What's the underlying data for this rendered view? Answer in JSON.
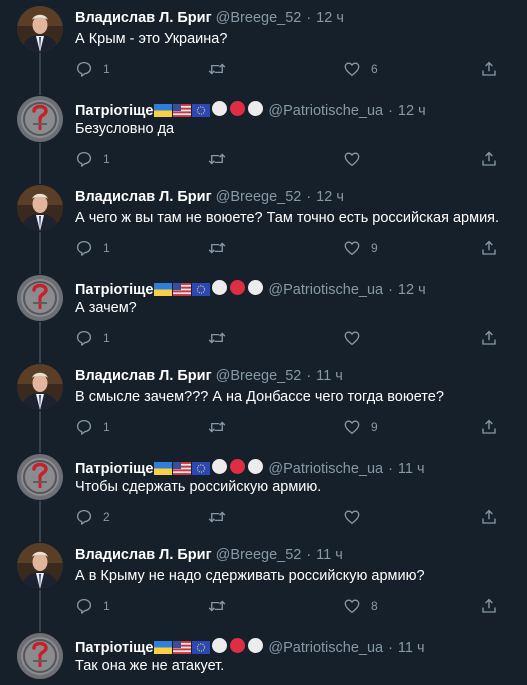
{
  "tweets": [
    {
      "author": "Владислав Л. Бриг",
      "handle": "@Breege_52",
      "time": "12 ч",
      "text": "А Крым - это Украина?",
      "replies": "1",
      "retweets": "",
      "likes": "6",
      "avatar": "man-in-suit"
    },
    {
      "author": "Патріотіще",
      "handle": "@Patriotische_ua",
      "time": "12 ч",
      "text": "Безусловно да",
      "replies": "1",
      "retweets": "",
      "likes": "",
      "avatar": "emblem"
    },
    {
      "author": "Владислав Л. Бриг",
      "handle": "@Breege_52",
      "time": "12 ч",
      "text": "А чего ж вы там не воюете? Там точно есть российская армия.",
      "replies": "1",
      "retweets": "",
      "likes": "9",
      "avatar": "man-in-suit"
    },
    {
      "author": "Патріотіще",
      "handle": "@Patriotische_ua",
      "time": "12 ч",
      "text": "А зачем?",
      "replies": "1",
      "retweets": "",
      "likes": "",
      "avatar": "emblem"
    },
    {
      "author": "Владислав Л. Бриг",
      "handle": "@Breege_52",
      "time": "11 ч",
      "text": "В смысле зачем??? А на Донбассе чего тогда воюете?",
      "replies": "1",
      "retweets": "",
      "likes": "9",
      "avatar": "man-in-suit"
    },
    {
      "author": "Патріотіще",
      "handle": "@Patriotische_ua",
      "time": "11 ч",
      "text": "Чтобы сдержать российскую армию.",
      "replies": "2",
      "retweets": "",
      "likes": "",
      "avatar": "emblem"
    },
    {
      "author": "Владислав Л. Бриг",
      "handle": "@Breege_52",
      "time": "11 ч",
      "text": "А в Крыму не надо сдерживать российскую армию?",
      "replies": "1",
      "retweets": "",
      "likes": "8",
      "avatar": "man-in-suit"
    },
    {
      "author": "Патріотіще",
      "handle": "@Patriotische_ua",
      "time": "11 ч",
      "text": "Так она же не атакует.",
      "replies": "",
      "retweets": "",
      "likes": "",
      "avatar": "emblem"
    }
  ],
  "name_flags": [
    "ukraine-flag-emoji",
    "usa-flag-emoji",
    "eu-flag-emoji",
    "white-circle-emoji",
    "red-circle-emoji",
    "white-circle-emoji"
  ],
  "separator": "·",
  "colors": {
    "background": "#15202b",
    "muted": "#8899a6",
    "thread_line": "#38444d",
    "text": "#ffffff"
  }
}
